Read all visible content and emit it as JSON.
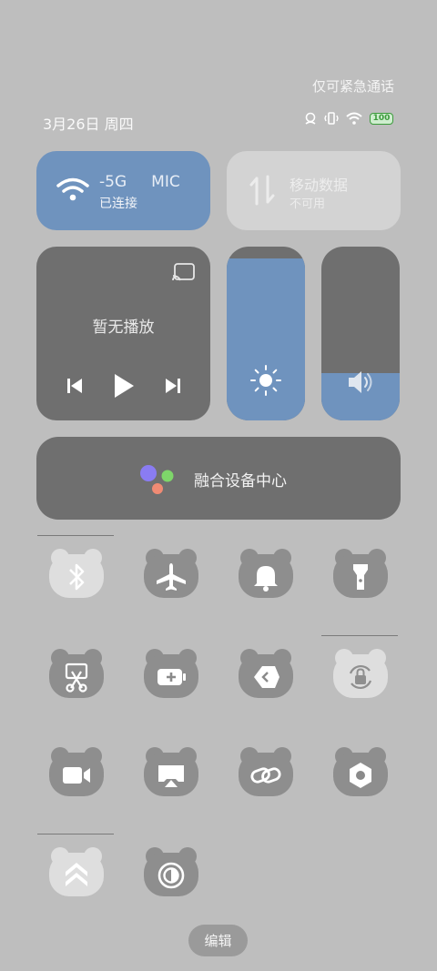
{
  "status": {
    "emergency_text": "仅可紧急通话",
    "date_text": "3月26日 周四",
    "battery_level": "100"
  },
  "wifi": {
    "name_part1": "-5G",
    "name_part2": "MIC",
    "state": "已连接"
  },
  "mobile_data": {
    "title": "移动数据",
    "state": "不可用"
  },
  "media": {
    "label": "暂无播放"
  },
  "brightness_level": 0.93,
  "volume_level": 0.27,
  "fusion": {
    "label": "融合设备中心"
  },
  "quick_toggles": [
    {
      "name": "bluetooth",
      "icon": "bluetooth-icon",
      "active": true
    },
    {
      "name": "airplane-mode",
      "icon": "airplane-icon",
      "active": false
    },
    {
      "name": "notifications",
      "icon": "bell-icon",
      "active": false
    },
    {
      "name": "flashlight",
      "icon": "flashlight-icon",
      "active": false
    },
    {
      "name": "screenshot",
      "icon": "scissors-icon",
      "active": false
    },
    {
      "name": "battery-saver",
      "icon": "battery-plus-icon",
      "active": false
    },
    {
      "name": "code-share",
      "icon": "code-icon",
      "active": false
    },
    {
      "name": "rotation-lock",
      "icon": "rotation-lock-icon",
      "active": true
    },
    {
      "name": "screen-record",
      "icon": "video-camera-icon",
      "active": false
    },
    {
      "name": "screen-cast",
      "icon": "cast-screen-icon",
      "active": false
    },
    {
      "name": "link",
      "icon": "link-icon",
      "active": false
    },
    {
      "name": "settings",
      "icon": "nut-icon",
      "active": false
    },
    {
      "name": "performance",
      "icon": "chevrons-up-icon",
      "active": true
    },
    {
      "name": "dark-mode",
      "icon": "contrast-icon",
      "active": false
    }
  ],
  "edit_label": "编辑",
  "colors": {
    "accent": "#6f93be",
    "tile_dark": "#6f6f6f",
    "background": "#bebebe"
  }
}
